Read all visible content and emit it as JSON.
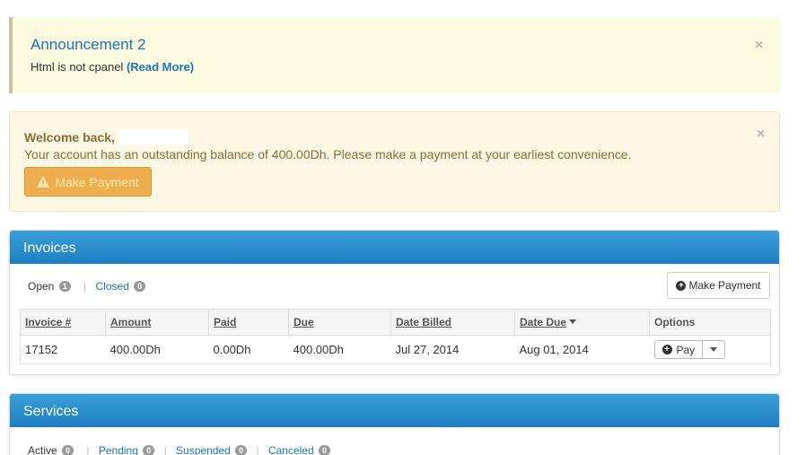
{
  "announcement": {
    "title": "Announcement 2",
    "text": "Html is not cpanel",
    "link_label": "(Read More)",
    "close_label": "×"
  },
  "welcome": {
    "greeting": "Welcome back,",
    "message": "Your account has an outstanding balance of 400.00Dh. Please make a payment at your earliest convenience.",
    "button_label": "Make Payment",
    "close_label": "×"
  },
  "invoices": {
    "title": "Invoices",
    "filters": [
      {
        "label": "Open",
        "count": "1"
      },
      {
        "label": "Closed",
        "count": "0"
      }
    ],
    "make_payment_label": "Make Payment",
    "columns": [
      "Invoice #",
      "Amount",
      "Paid",
      "Due",
      "Date Billed",
      "Date Due",
      "Options"
    ],
    "rows": [
      {
        "invoice": "17152",
        "amount": "400.00Dh",
        "paid": "0.00Dh",
        "due": "400.00Dh",
        "date_billed": "Jul 27, 2014",
        "date_due": "Aug 01, 2014",
        "action": "Pay"
      }
    ]
  },
  "services": {
    "title": "Services",
    "filters": [
      {
        "label": "Active",
        "count": "0"
      },
      {
        "label": "Pending",
        "count": "0"
      },
      {
        "label": "Suspended",
        "count": "0"
      },
      {
        "label": "Canceled",
        "count": "0"
      }
    ]
  },
  "colors": {
    "accent": "#1a74b5",
    "panel_header": "#2a8fcf",
    "warning_button": "#f0ad4e"
  }
}
